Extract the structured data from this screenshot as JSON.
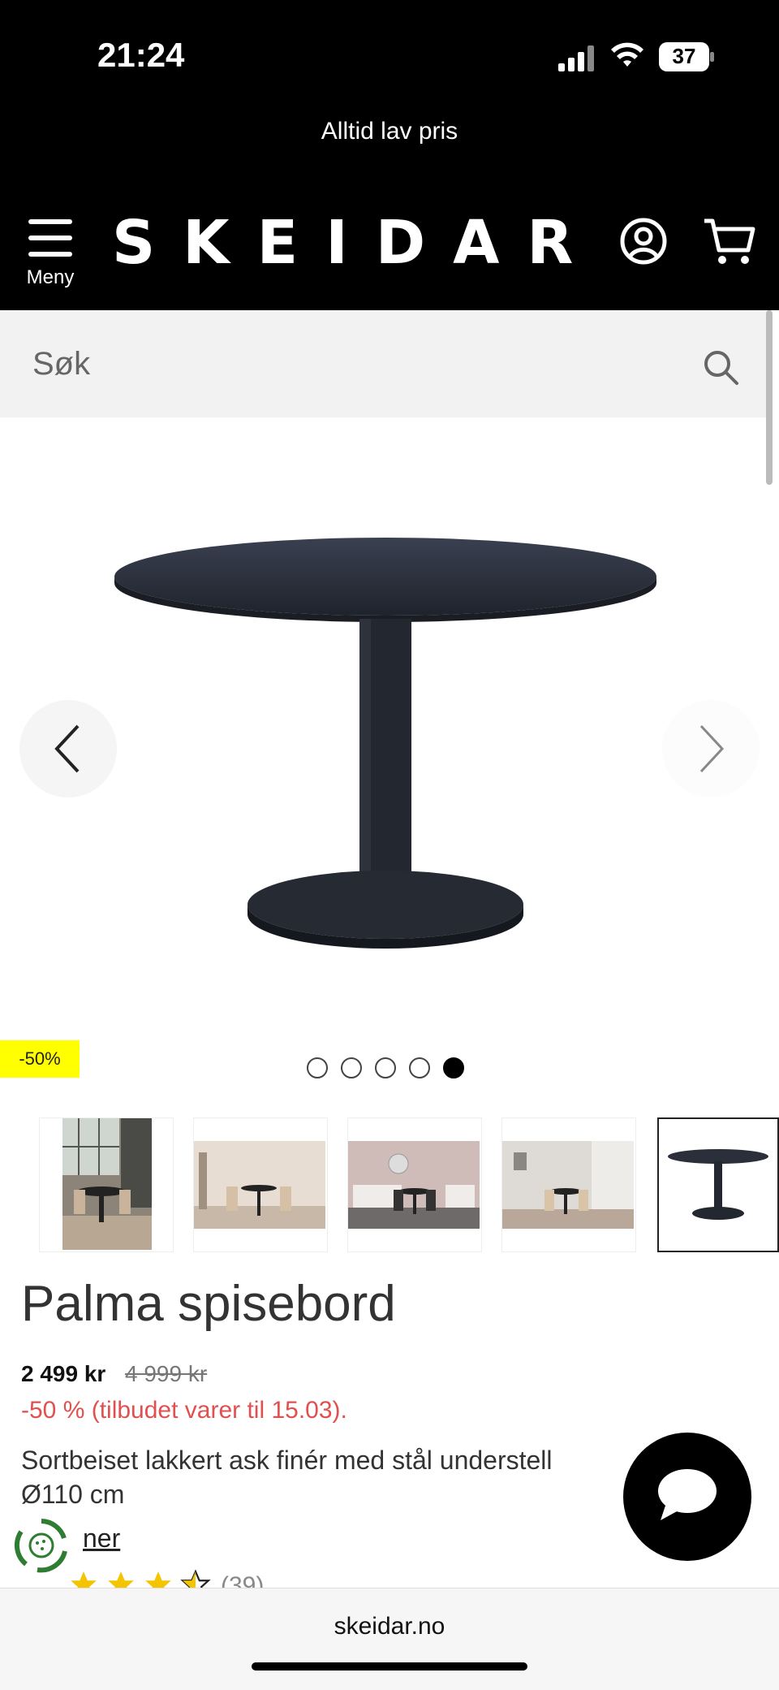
{
  "status_bar": {
    "time": "21:24",
    "battery": "37"
  },
  "promo": {
    "text": "Alltid lav pris"
  },
  "header": {
    "menu_label": "Meny",
    "logo": "SKEIDAR"
  },
  "search": {
    "placeholder": "Søk"
  },
  "gallery": {
    "badge": "-50%",
    "dots_total": 5,
    "active_dot": 5,
    "thumbnail_count": 5,
    "selected_thumbnail": 5
  },
  "product": {
    "title": "Palma spisebord",
    "price": "2 499 kr",
    "old_price": "4 999 kr",
    "offer": "-50 % (tilbudet varer til 15.03).",
    "description_line1": "Sortbeiset lakkert ask finér med stål understell",
    "description_line2": "Ø110 cm",
    "link_text": "ner",
    "rating": 3.5,
    "review_count": "(39)"
  },
  "url_bar": {
    "url": "skeidar.no"
  },
  "colors": {
    "header_bg": "#000000",
    "badge_bg": "#ffff00",
    "offer_text": "#e05050",
    "star": "#f4c400"
  }
}
